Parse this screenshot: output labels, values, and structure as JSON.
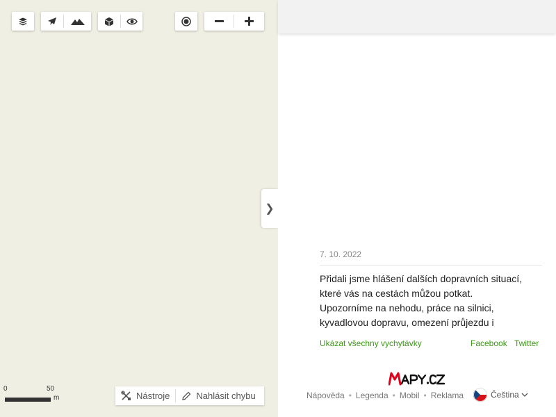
{
  "map": {
    "controls": {
      "layers_icon": "layers-icon",
      "plane_icon": "plane-icon",
      "terrain_icon": "terrain-icon",
      "cube_icon": "cube-icon",
      "eye_icon": "eye-icon",
      "locate_icon": "locate-icon",
      "zoom_out_icon": "minus-icon",
      "zoom_in_icon": "plus-icon"
    },
    "scale": {
      "zero": "0",
      "max": "50",
      "unit": "m"
    },
    "tools": {
      "tools_label": "Nástroje",
      "report_label": "Nahlásit chybu"
    }
  },
  "panel": {
    "collapse_glyph": "❯",
    "news": {
      "date": "7. 10. 2022",
      "text": "Přidali jsme hlášení dalších dopravních situací, které vás na cestách můžou potkat. Upozorníme na nehodu, práce na silnici, kyvadlovou dopravu, omezení průjezdu i",
      "show_all": "Ukázat všechny vychytávky",
      "facebook": "Facebook",
      "twitter": "Twitter"
    },
    "logo_text": "MAPY.CZ",
    "footer": {
      "links": [
        "Nápověda",
        "Legenda",
        "Mobil",
        "Reklama"
      ],
      "language": "Čeština"
    }
  },
  "colors": {
    "map_bg": "#f0efe4",
    "accent_green": "#3a9a14",
    "logo_red": "#e3001b"
  }
}
